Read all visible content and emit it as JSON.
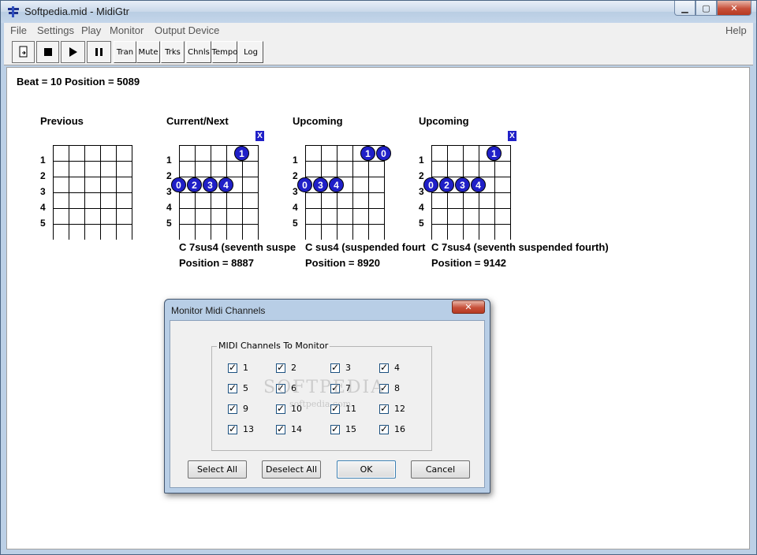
{
  "window": {
    "title": "Softpedia.mid - MidiGtr",
    "controls": {
      "minimize": "▁",
      "maximize": "▢",
      "close": "✕"
    }
  },
  "menu": {
    "items": [
      "File",
      "Settings",
      "Play",
      "Monitor",
      "Output Device"
    ],
    "help": "Help"
  },
  "toolbar": {
    "buttons": [
      {
        "label": "",
        "icon": "open-icon"
      },
      {
        "label": "",
        "icon": "stop-icon"
      },
      {
        "label": "",
        "icon": "play-icon"
      },
      {
        "label": "",
        "icon": "pause-icon"
      },
      {
        "label": "Tran"
      },
      {
        "label": "Mute"
      },
      {
        "label": "Trks"
      },
      {
        "label": "Chnls"
      },
      {
        "label": "Tempo"
      },
      {
        "label": "Log"
      }
    ]
  },
  "status": {
    "beat_line": "Beat = 10 Position = 5089"
  },
  "diagrams": [
    {
      "label": "Previous",
      "frets": [
        "1",
        "2",
        "3",
        "4",
        "5"
      ],
      "chord": "",
      "position": ""
    },
    {
      "label": "Current/Next",
      "frets": [
        "1",
        "2",
        "3",
        "4",
        "5"
      ],
      "chord": "C 7sus4 (seventh suspe",
      "position": "Position = 8887",
      "dots": [
        {
          "text": "1"
        },
        {
          "text": "0"
        },
        {
          "text": "2"
        },
        {
          "text": "3"
        },
        {
          "text": "4"
        }
      ],
      "muted": "X"
    },
    {
      "label": "Upcoming",
      "frets": [
        "1",
        "2",
        "3",
        "4",
        "5"
      ],
      "chord": "C sus4 (suspended fourt",
      "position": "Position = 8920",
      "dots": [
        {
          "text": "1"
        },
        {
          "text": "0"
        },
        {
          "text": "0"
        },
        {
          "text": "3"
        },
        {
          "text": "4"
        }
      ]
    },
    {
      "label": "Upcoming",
      "frets": [
        "1",
        "2",
        "3",
        "4",
        "5"
      ],
      "chord": "C 7sus4 (seventh suspended fourth)",
      "position": "Position = 9142",
      "dots": [
        {
          "text": "1"
        },
        {
          "text": "0"
        },
        {
          "text": "2"
        },
        {
          "text": "3"
        },
        {
          "text": "4"
        }
      ],
      "muted": "X"
    }
  ],
  "dialog": {
    "title": "Monitor Midi Channels",
    "close": "✕",
    "group_label": "MIDI Channels To Monitor",
    "channels": [
      {
        "label": "1",
        "checked": true
      },
      {
        "label": "2",
        "checked": true
      },
      {
        "label": "3",
        "checked": true
      },
      {
        "label": "4",
        "checked": true
      },
      {
        "label": "5",
        "checked": true
      },
      {
        "label": "6",
        "checked": true
      },
      {
        "label": "7",
        "checked": true
      },
      {
        "label": "8",
        "checked": true
      },
      {
        "label": "9",
        "checked": true
      },
      {
        "label": "10",
        "checked": true
      },
      {
        "label": "11",
        "checked": true
      },
      {
        "label": "12",
        "checked": true
      },
      {
        "label": "13",
        "checked": true
      },
      {
        "label": "14",
        "checked": true
      },
      {
        "label": "15",
        "checked": true
      },
      {
        "label": "16",
        "checked": true
      }
    ],
    "buttons": {
      "select_all": "Select All",
      "deselect_all": "Deselect All",
      "ok": "OK",
      "cancel": "Cancel"
    }
  },
  "watermark": {
    "main": "SOFTPEDIA",
    "sub": "softpedia.com"
  }
}
